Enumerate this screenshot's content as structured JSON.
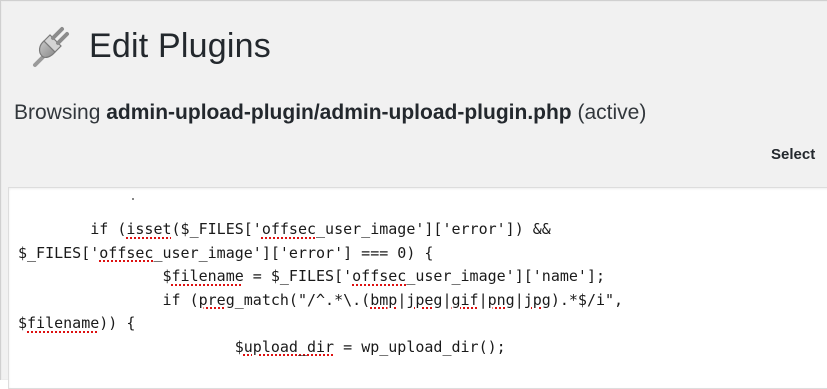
{
  "header": {
    "icon": "plugin-plug-icon",
    "title": "Edit Plugins"
  },
  "browsing": {
    "prefix": "Browsing",
    "file": "admin-upload-plugin/admin-upload-plugin.php",
    "status": "(active)"
  },
  "select_label": "Select",
  "code": {
    "line1": {
      "a": "        if (",
      "b": "isset",
      "c": "($_FILES['",
      "d": "offsec",
      "e": "_user_image']['error']) &&"
    },
    "line2": {
      "a": "$_FILES['",
      "b": "offsec",
      "c": "_user_image']['error'] === 0) {"
    },
    "line3": {
      "a": "                $",
      "b": "filename",
      "c": " = $_FILES['",
      "d": "offsec",
      "e": "_user_image']['name'];"
    },
    "line4": {
      "a": "                if (",
      "b": "preg",
      "c": "_match(\"/^.*\\.(",
      "d": "bmp",
      "e": "|",
      "f": "jpeg",
      "g": "|",
      "h": "gif",
      "i": "|",
      "j": "png",
      "k": "|",
      "l": "jpg",
      "m": ").*$/i\","
    },
    "line5": {
      "a": "$",
      "b": "filename",
      "c": ")) {"
    },
    "line6": {
      "a": "                        $",
      "b": "upload_dir",
      "c": " = ",
      "d": "wp_upload_dir",
      "e": "();"
    }
  }
}
